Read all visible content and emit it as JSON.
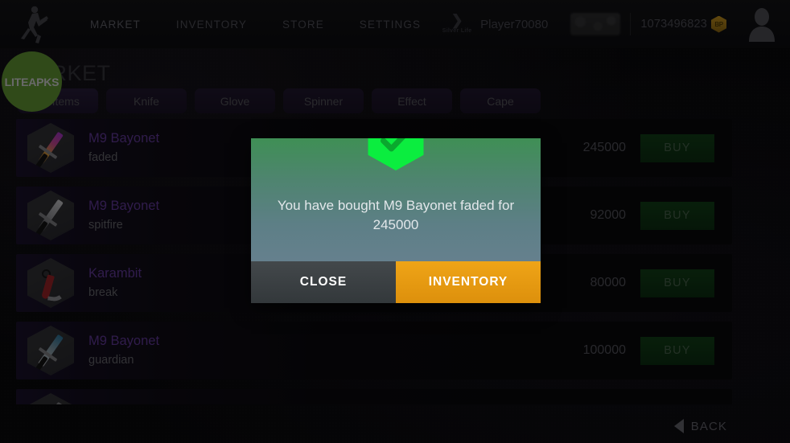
{
  "topbar": {
    "logo_icon": "runner-logo-icon",
    "nav": [
      {
        "label": "MARKET",
        "name": "market"
      },
      {
        "label": "INVENTORY",
        "name": "inventory"
      },
      {
        "label": "STORE",
        "name": "store"
      },
      {
        "label": "SETTINGS",
        "name": "settings"
      }
    ],
    "rank": {
      "glyph": "❯",
      "label": "Silver Life",
      "icon": "rank-chevron-icon"
    },
    "player_name": "Player70080",
    "currency": {
      "amount": "1073496823",
      "badge": "BP",
      "icon": "bp-hexagon-icon"
    },
    "avatar_icon": "user-avatar-icon"
  },
  "page": {
    "title": "MARKET",
    "watermark": "LITEAPKS"
  },
  "filters": [
    {
      "label": "All Items",
      "name": "all-items",
      "selected": true
    },
    {
      "label": "Knife",
      "name": "knife",
      "selected": false
    },
    {
      "label": "Glove",
      "name": "glove",
      "selected": false
    },
    {
      "label": "Spinner",
      "name": "spinner",
      "selected": false
    },
    {
      "label": "Effect",
      "name": "effect",
      "selected": false
    },
    {
      "label": "Cape",
      "name": "cape",
      "selected": false
    }
  ],
  "list": {
    "buy_label": "BUY",
    "items": [
      {
        "name": "M9 Bayonet",
        "skin": "faded",
        "price": "245000",
        "icon": "knife-faded-icon"
      },
      {
        "name": "M9 Bayonet",
        "skin": "spitfire",
        "price": "92000",
        "icon": "knife-spitfire-icon"
      },
      {
        "name": "Karambit",
        "skin": "break",
        "price": "80000",
        "icon": "karambit-break-icon"
      },
      {
        "name": "M9 Bayonet",
        "skin": "guardian",
        "price": "100000",
        "icon": "knife-guardian-icon"
      }
    ]
  },
  "back": {
    "label": "BACK",
    "icon": "back-arrow-icon"
  },
  "modal": {
    "icon": "success-check-hexagon-icon",
    "message": "You have bought M9 Bayonet faded for 245000",
    "close_label": "CLOSE",
    "inventory_label": "INVENTORY"
  },
  "colors": {
    "accent_green": "#0bed3f",
    "accent_orange": "#efa417",
    "buy_green": "#13451a",
    "item_name_purple": "#6b3fa8",
    "watermark_green": "#6ba439",
    "bp_gold": "#d7a122"
  }
}
